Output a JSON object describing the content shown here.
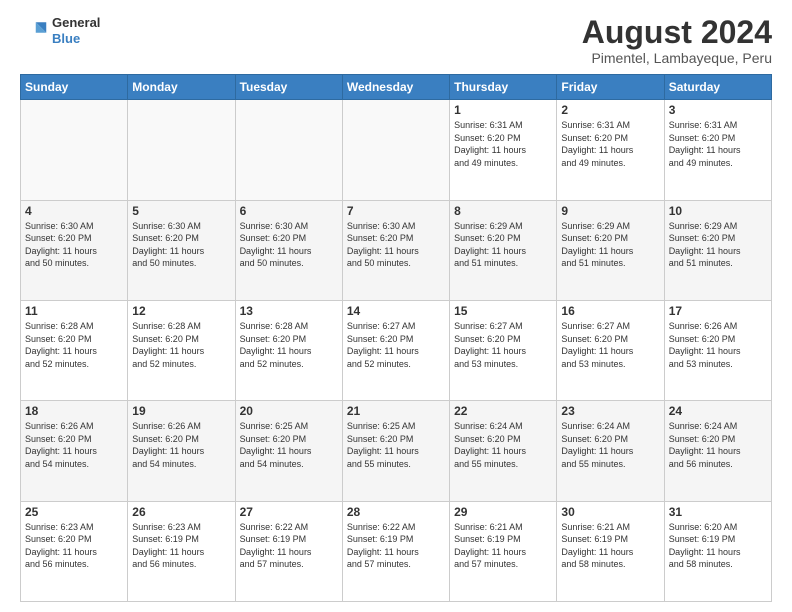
{
  "header": {
    "logo_line1": "General",
    "logo_line2": "Blue",
    "title": "August 2024",
    "subtitle": "Pimentel, Lambayeque, Peru"
  },
  "weekdays": [
    "Sunday",
    "Monday",
    "Tuesday",
    "Wednesday",
    "Thursday",
    "Friday",
    "Saturday"
  ],
  "weeks": [
    [
      {
        "day": "",
        "info": ""
      },
      {
        "day": "",
        "info": ""
      },
      {
        "day": "",
        "info": ""
      },
      {
        "day": "",
        "info": ""
      },
      {
        "day": "1",
        "info": "Sunrise: 6:31 AM\nSunset: 6:20 PM\nDaylight: 11 hours\nand 49 minutes."
      },
      {
        "day": "2",
        "info": "Sunrise: 6:31 AM\nSunset: 6:20 PM\nDaylight: 11 hours\nand 49 minutes."
      },
      {
        "day": "3",
        "info": "Sunrise: 6:31 AM\nSunset: 6:20 PM\nDaylight: 11 hours\nand 49 minutes."
      }
    ],
    [
      {
        "day": "4",
        "info": "Sunrise: 6:30 AM\nSunset: 6:20 PM\nDaylight: 11 hours\nand 50 minutes."
      },
      {
        "day": "5",
        "info": "Sunrise: 6:30 AM\nSunset: 6:20 PM\nDaylight: 11 hours\nand 50 minutes."
      },
      {
        "day": "6",
        "info": "Sunrise: 6:30 AM\nSunset: 6:20 PM\nDaylight: 11 hours\nand 50 minutes."
      },
      {
        "day": "7",
        "info": "Sunrise: 6:30 AM\nSunset: 6:20 PM\nDaylight: 11 hours\nand 50 minutes."
      },
      {
        "day": "8",
        "info": "Sunrise: 6:29 AM\nSunset: 6:20 PM\nDaylight: 11 hours\nand 51 minutes."
      },
      {
        "day": "9",
        "info": "Sunrise: 6:29 AM\nSunset: 6:20 PM\nDaylight: 11 hours\nand 51 minutes."
      },
      {
        "day": "10",
        "info": "Sunrise: 6:29 AM\nSunset: 6:20 PM\nDaylight: 11 hours\nand 51 minutes."
      }
    ],
    [
      {
        "day": "11",
        "info": "Sunrise: 6:28 AM\nSunset: 6:20 PM\nDaylight: 11 hours\nand 52 minutes."
      },
      {
        "day": "12",
        "info": "Sunrise: 6:28 AM\nSunset: 6:20 PM\nDaylight: 11 hours\nand 52 minutes."
      },
      {
        "day": "13",
        "info": "Sunrise: 6:28 AM\nSunset: 6:20 PM\nDaylight: 11 hours\nand 52 minutes."
      },
      {
        "day": "14",
        "info": "Sunrise: 6:27 AM\nSunset: 6:20 PM\nDaylight: 11 hours\nand 52 minutes."
      },
      {
        "day": "15",
        "info": "Sunrise: 6:27 AM\nSunset: 6:20 PM\nDaylight: 11 hours\nand 53 minutes."
      },
      {
        "day": "16",
        "info": "Sunrise: 6:27 AM\nSunset: 6:20 PM\nDaylight: 11 hours\nand 53 minutes."
      },
      {
        "day": "17",
        "info": "Sunrise: 6:26 AM\nSunset: 6:20 PM\nDaylight: 11 hours\nand 53 minutes."
      }
    ],
    [
      {
        "day": "18",
        "info": "Sunrise: 6:26 AM\nSunset: 6:20 PM\nDaylight: 11 hours\nand 54 minutes."
      },
      {
        "day": "19",
        "info": "Sunrise: 6:26 AM\nSunset: 6:20 PM\nDaylight: 11 hours\nand 54 minutes."
      },
      {
        "day": "20",
        "info": "Sunrise: 6:25 AM\nSunset: 6:20 PM\nDaylight: 11 hours\nand 54 minutes."
      },
      {
        "day": "21",
        "info": "Sunrise: 6:25 AM\nSunset: 6:20 PM\nDaylight: 11 hours\nand 55 minutes."
      },
      {
        "day": "22",
        "info": "Sunrise: 6:24 AM\nSunset: 6:20 PM\nDaylight: 11 hours\nand 55 minutes."
      },
      {
        "day": "23",
        "info": "Sunrise: 6:24 AM\nSunset: 6:20 PM\nDaylight: 11 hours\nand 55 minutes."
      },
      {
        "day": "24",
        "info": "Sunrise: 6:24 AM\nSunset: 6:20 PM\nDaylight: 11 hours\nand 56 minutes."
      }
    ],
    [
      {
        "day": "25",
        "info": "Sunrise: 6:23 AM\nSunset: 6:20 PM\nDaylight: 11 hours\nand 56 minutes."
      },
      {
        "day": "26",
        "info": "Sunrise: 6:23 AM\nSunset: 6:19 PM\nDaylight: 11 hours\nand 56 minutes."
      },
      {
        "day": "27",
        "info": "Sunrise: 6:22 AM\nSunset: 6:19 PM\nDaylight: 11 hours\nand 57 minutes."
      },
      {
        "day": "28",
        "info": "Sunrise: 6:22 AM\nSunset: 6:19 PM\nDaylight: 11 hours\nand 57 minutes."
      },
      {
        "day": "29",
        "info": "Sunrise: 6:21 AM\nSunset: 6:19 PM\nDaylight: 11 hours\nand 57 minutes."
      },
      {
        "day": "30",
        "info": "Sunrise: 6:21 AM\nSunset: 6:19 PM\nDaylight: 11 hours\nand 58 minutes."
      },
      {
        "day": "31",
        "info": "Sunrise: 6:20 AM\nSunset: 6:19 PM\nDaylight: 11 hours\nand 58 minutes."
      }
    ]
  ]
}
